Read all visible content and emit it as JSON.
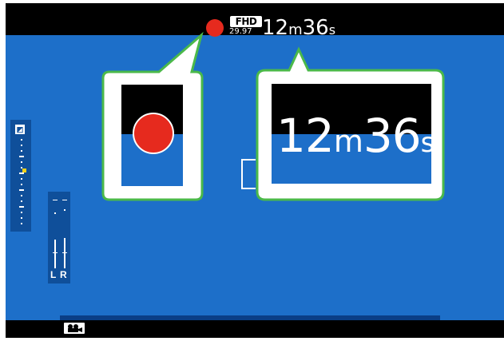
{
  "top_status": {
    "video_format": "FHD",
    "frame_rate": "29.97",
    "recording_time": {
      "minutes": "12",
      "minutes_unit": "m",
      "seconds": "36",
      "seconds_unit": "s"
    }
  },
  "callout_recording_indicator": {
    "icon": "record-dot-icon"
  },
  "callout_recording_time": {
    "minutes": "12",
    "minutes_unit": "m",
    "seconds": "36",
    "seconds_unit": "s"
  },
  "audio_meter": {
    "left_label": "L",
    "right_label": "R"
  },
  "icons": {
    "recording": "record-dot-icon",
    "exposure": "exposure-compensation-icon",
    "mode": "movie-mode-icon"
  },
  "colors": {
    "screen_blue": "#1d6fc9",
    "record_red": "#e62a1e",
    "callout_border": "#4bb94a"
  }
}
